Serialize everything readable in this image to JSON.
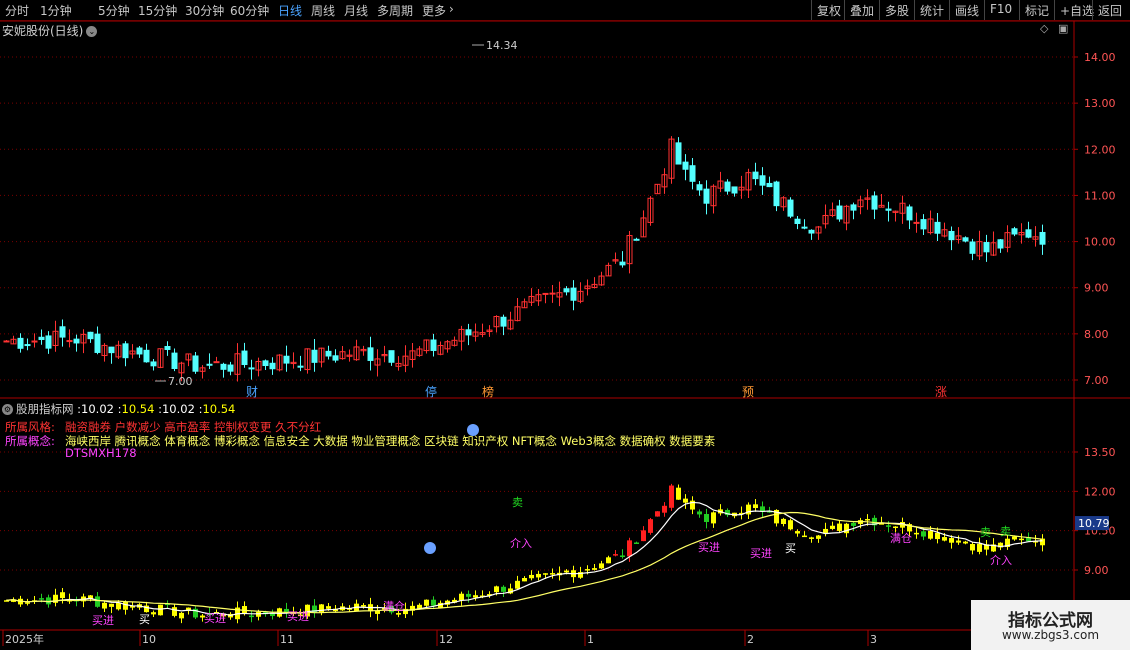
{
  "toolbar": {
    "left_items": [
      "分时",
      "1分钟",
      "5分钟",
      "15分钟",
      "30分钟",
      "60分钟",
      "日线",
      "周线",
      "月线",
      "多周期",
      "更多"
    ],
    "active": "日线",
    "right_items": [
      "复权",
      "叠加",
      "多股",
      "统计",
      "画线",
      "F10",
      "标记",
      "+自选",
      "返回"
    ]
  },
  "main": {
    "title": "安妮股份(日线)",
    "high_label": "14.34",
    "low_label": "7.00",
    "y_ticks": [
      "14.00",
      "13.00",
      "12.00",
      "11.00",
      "10.00",
      "9.00",
      "8.00",
      "7.00"
    ],
    "event_markers": [
      {
        "text": "财",
        "color": "#4aa3ff"
      },
      {
        "text": "停",
        "color": "#4aa3ff"
      },
      {
        "text": "榜",
        "color": "#ff9933"
      },
      {
        "text": "预",
        "color": "#ff9933"
      },
      {
        "text": "涨",
        "color": "#ff3333"
      }
    ]
  },
  "indicator": {
    "name": "股朋指标网",
    "values": [
      {
        "text": "10.02",
        "color": "#ffffff"
      },
      {
        "text": "10.54",
        "color": "#ffff00"
      },
      {
        "text": "10.02",
        "color": "#ffffff"
      },
      {
        "text": "10.54",
        "color": "#ffff00"
      }
    ],
    "style_label": "所属风格:",
    "style_value": "融资融券 户数减少 高市盈率 控制权变更 久不分红",
    "concept_label": "所属概念:",
    "concept_value": "海峡西岸 腾讯概念 体育概念 博彩概念 信息安全 大数据 物业管理概念 区块链 知识产权 NFT概念 Web3概念 数据确权 数据要素",
    "code": "DTSMXH178",
    "y_ticks": [
      "13.50",
      "12.00",
      "10.50",
      "9.00"
    ],
    "current_price": "10.79",
    "signals": [
      "买进",
      "买",
      "买进",
      "买进",
      "满仓",
      "卖",
      "介入",
      "买进",
      "买进",
      "买",
      "卖",
      "满仓",
      "卖",
      "介入"
    ],
    "emoji": "☹"
  },
  "time_axis": {
    "labels": [
      "2025年",
      "10",
      "11",
      "12",
      "1",
      "2",
      "3"
    ]
  },
  "watermark": {
    "line1": "指标公式网",
    "line2": "www.zbgs3.com"
  },
  "colors": {
    "up": "#ff3232",
    "down": "#54ffff",
    "up_sub": "#ff2020",
    "yellow": "#ffff00",
    "green": "#22cc22",
    "orange": "#ffaa44",
    "grid": "#7a0000",
    "axis": "#aa0000"
  }
}
